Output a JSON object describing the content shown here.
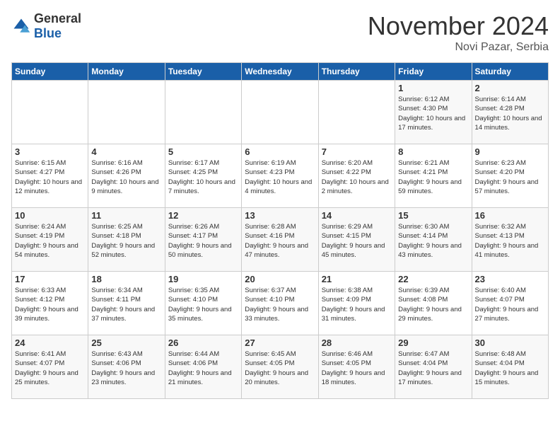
{
  "header": {
    "logo_general": "General",
    "logo_blue": "Blue",
    "month_title": "November 2024",
    "location": "Novi Pazar, Serbia"
  },
  "days_of_week": [
    "Sunday",
    "Monday",
    "Tuesday",
    "Wednesday",
    "Thursday",
    "Friday",
    "Saturday"
  ],
  "weeks": [
    [
      {
        "day": "",
        "info": ""
      },
      {
        "day": "",
        "info": ""
      },
      {
        "day": "",
        "info": ""
      },
      {
        "day": "",
        "info": ""
      },
      {
        "day": "",
        "info": ""
      },
      {
        "day": "1",
        "info": "Sunrise: 6:12 AM\nSunset: 4:30 PM\nDaylight: 10 hours and 17 minutes."
      },
      {
        "day": "2",
        "info": "Sunrise: 6:14 AM\nSunset: 4:28 PM\nDaylight: 10 hours and 14 minutes."
      }
    ],
    [
      {
        "day": "3",
        "info": "Sunrise: 6:15 AM\nSunset: 4:27 PM\nDaylight: 10 hours and 12 minutes."
      },
      {
        "day": "4",
        "info": "Sunrise: 6:16 AM\nSunset: 4:26 PM\nDaylight: 10 hours and 9 minutes."
      },
      {
        "day": "5",
        "info": "Sunrise: 6:17 AM\nSunset: 4:25 PM\nDaylight: 10 hours and 7 minutes."
      },
      {
        "day": "6",
        "info": "Sunrise: 6:19 AM\nSunset: 4:23 PM\nDaylight: 10 hours and 4 minutes."
      },
      {
        "day": "7",
        "info": "Sunrise: 6:20 AM\nSunset: 4:22 PM\nDaylight: 10 hours and 2 minutes."
      },
      {
        "day": "8",
        "info": "Sunrise: 6:21 AM\nSunset: 4:21 PM\nDaylight: 9 hours and 59 minutes."
      },
      {
        "day": "9",
        "info": "Sunrise: 6:23 AM\nSunset: 4:20 PM\nDaylight: 9 hours and 57 minutes."
      }
    ],
    [
      {
        "day": "10",
        "info": "Sunrise: 6:24 AM\nSunset: 4:19 PM\nDaylight: 9 hours and 54 minutes."
      },
      {
        "day": "11",
        "info": "Sunrise: 6:25 AM\nSunset: 4:18 PM\nDaylight: 9 hours and 52 minutes."
      },
      {
        "day": "12",
        "info": "Sunrise: 6:26 AM\nSunset: 4:17 PM\nDaylight: 9 hours and 50 minutes."
      },
      {
        "day": "13",
        "info": "Sunrise: 6:28 AM\nSunset: 4:16 PM\nDaylight: 9 hours and 47 minutes."
      },
      {
        "day": "14",
        "info": "Sunrise: 6:29 AM\nSunset: 4:15 PM\nDaylight: 9 hours and 45 minutes."
      },
      {
        "day": "15",
        "info": "Sunrise: 6:30 AM\nSunset: 4:14 PM\nDaylight: 9 hours and 43 minutes."
      },
      {
        "day": "16",
        "info": "Sunrise: 6:32 AM\nSunset: 4:13 PM\nDaylight: 9 hours and 41 minutes."
      }
    ],
    [
      {
        "day": "17",
        "info": "Sunrise: 6:33 AM\nSunset: 4:12 PM\nDaylight: 9 hours and 39 minutes."
      },
      {
        "day": "18",
        "info": "Sunrise: 6:34 AM\nSunset: 4:11 PM\nDaylight: 9 hours and 37 minutes."
      },
      {
        "day": "19",
        "info": "Sunrise: 6:35 AM\nSunset: 4:10 PM\nDaylight: 9 hours and 35 minutes."
      },
      {
        "day": "20",
        "info": "Sunrise: 6:37 AM\nSunset: 4:10 PM\nDaylight: 9 hours and 33 minutes."
      },
      {
        "day": "21",
        "info": "Sunrise: 6:38 AM\nSunset: 4:09 PM\nDaylight: 9 hours and 31 minutes."
      },
      {
        "day": "22",
        "info": "Sunrise: 6:39 AM\nSunset: 4:08 PM\nDaylight: 9 hours and 29 minutes."
      },
      {
        "day": "23",
        "info": "Sunrise: 6:40 AM\nSunset: 4:07 PM\nDaylight: 9 hours and 27 minutes."
      }
    ],
    [
      {
        "day": "24",
        "info": "Sunrise: 6:41 AM\nSunset: 4:07 PM\nDaylight: 9 hours and 25 minutes."
      },
      {
        "day": "25",
        "info": "Sunrise: 6:43 AM\nSunset: 4:06 PM\nDaylight: 9 hours and 23 minutes."
      },
      {
        "day": "26",
        "info": "Sunrise: 6:44 AM\nSunset: 4:06 PM\nDaylight: 9 hours and 21 minutes."
      },
      {
        "day": "27",
        "info": "Sunrise: 6:45 AM\nSunset: 4:05 PM\nDaylight: 9 hours and 20 minutes."
      },
      {
        "day": "28",
        "info": "Sunrise: 6:46 AM\nSunset: 4:05 PM\nDaylight: 9 hours and 18 minutes."
      },
      {
        "day": "29",
        "info": "Sunrise: 6:47 AM\nSunset: 4:04 PM\nDaylight: 9 hours and 17 minutes."
      },
      {
        "day": "30",
        "info": "Sunrise: 6:48 AM\nSunset: 4:04 PM\nDaylight: 9 hours and 15 minutes."
      }
    ]
  ]
}
